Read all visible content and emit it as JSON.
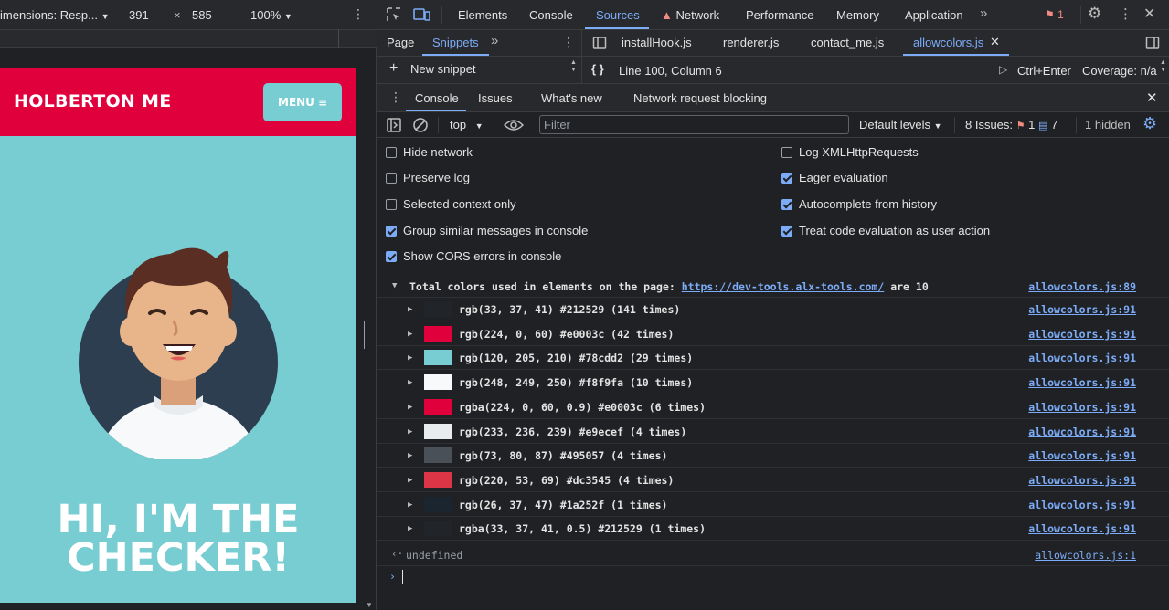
{
  "device_toolbar": {
    "dimensions_label": "imensions: Resp...",
    "width": "391",
    "times": "×",
    "height": "585",
    "zoom": "100%"
  },
  "site": {
    "brand": "HOLBERTON ME",
    "menu_label": "MENU",
    "hero_line1": "HI, I'M THE",
    "hero_line2": "CHECKER!",
    "colors": {
      "header": "#e0003c",
      "body": "#78cdd2",
      "menu_bg": "#78cdd2"
    }
  },
  "devtools": {
    "main_tabs": [
      "Elements",
      "Console",
      "Sources",
      "Network",
      "Performance",
      "Memory",
      "Application"
    ],
    "active_main_tab": "Sources",
    "issues_badge": "1",
    "sources_nav_tabs": [
      "Page",
      "Snippets"
    ],
    "active_nav_tab": "Snippets",
    "new_snippet_label": "New snippet",
    "file_tabs": [
      "installHook.js",
      "renderer.js",
      "contact_me.js",
      "allowcolors.js"
    ],
    "active_file_tab": "allowcolors.js",
    "cursor_position": "Line 100, Column 6",
    "run_shortcut": "Ctrl+Enter",
    "coverage": "Coverage: n/a",
    "drawer_tabs": [
      "Console",
      "Issues",
      "What's new",
      "Network request blocking"
    ],
    "active_drawer_tab": "Console",
    "console_toolbar": {
      "context": "top",
      "filter_placeholder": "Filter",
      "levels": "Default levels",
      "issues_label": "8 Issues:",
      "issues_errors": "1",
      "issues_info": "7",
      "hidden": "1 hidden"
    },
    "settings_left": [
      {
        "label": "Hide network",
        "checked": false
      },
      {
        "label": "Preserve log",
        "checked": false
      },
      {
        "label": "Selected context only",
        "checked": false
      },
      {
        "label": "Group similar messages in console",
        "checked": true
      },
      {
        "label": "Show CORS errors in console",
        "checked": true
      }
    ],
    "settings_right": [
      {
        "label": "Log XMLHttpRequests",
        "checked": false
      },
      {
        "label": "Eager evaluation",
        "checked": true
      },
      {
        "label": "Autocomplete from history",
        "checked": true
      },
      {
        "label": "Treat code evaluation as user action",
        "checked": true
      }
    ],
    "log": {
      "summary_prefix": "Total colors used in elements on the page: ",
      "summary_url": "https://dev-tools.alx-tools.com/",
      "summary_suffix": " are 10",
      "summary_source": "allowcolors.js:89",
      "entries": [
        {
          "text": "rgb(33, 37, 41) #212529 (141 times)",
          "swatch": "#212529",
          "source": "allowcolors.js:91"
        },
        {
          "text": "rgb(224, 0, 60) #e0003c (42 times)",
          "swatch": "#e0003c",
          "source": "allowcolors.js:91"
        },
        {
          "text": "rgb(120, 205, 210) #78cdd2 (29 times)",
          "swatch": "#78cdd2",
          "source": "allowcolors.js:91"
        },
        {
          "text": "rgb(248, 249, 250) #f8f9fa (10 times)",
          "swatch": "#f8f9fa",
          "source": "allowcolors.js:91"
        },
        {
          "text": "rgba(224, 0, 60, 0.9) #e0003c (6 times)",
          "swatch": "#e0003c",
          "source": "allowcolors.js:91"
        },
        {
          "text": "rgb(233, 236, 239) #e9ecef (4 times)",
          "swatch": "#e9ecef",
          "source": "allowcolors.js:91"
        },
        {
          "text": "rgb(73, 80, 87) #495057 (4 times)",
          "swatch": "#495057",
          "source": "allowcolors.js:91"
        },
        {
          "text": "rgb(220, 53, 69) #dc3545 (4 times)",
          "swatch": "#dc3545",
          "source": "allowcolors.js:91"
        },
        {
          "text": "rgb(26, 37, 47) #1a252f (1 times)",
          "swatch": "#1a252f",
          "source": "allowcolors.js:91"
        },
        {
          "text": "rgba(33, 37, 41, 0.5) #212529 (1 times)",
          "swatch": "#212529",
          "source": "allowcolors.js:91"
        }
      ],
      "return_value": "undefined",
      "return_source": "allowcolors.js:1"
    },
    "accent_color": "#7cacf8"
  }
}
